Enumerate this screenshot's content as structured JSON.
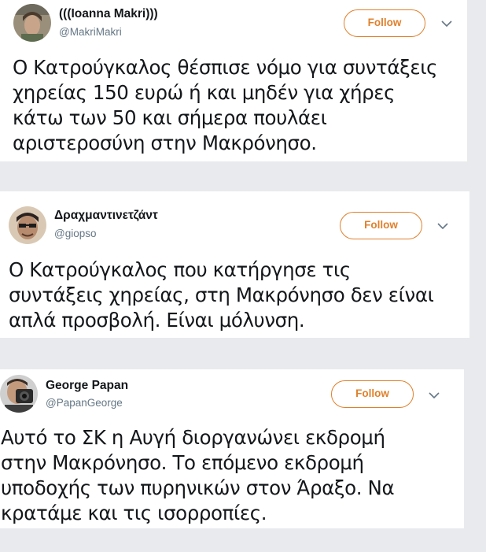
{
  "tweets": [
    {
      "name": "(((Ioanna Makri)))",
      "handle": "@MakriMakri",
      "follow_label": "Follow",
      "text": "Ο Κατρούγκαλος θέσπισε νόμο για συντάξεις\nχηρείας 150 ευρώ ή και μηδέν για χήρες\nκάτω των 50 και σήμερα πουλάει\nαριστεροσύνη στην Μακρόνησο."
    },
    {
      "name": "Δραχμαντινετζάντ",
      "handle": "@giopso",
      "follow_label": "Follow",
      "text": "Ο Κατρούγκαλος που κατήργησε τις\nσυντάξεις χηρείας, στη Μακρόνησο δεν είναι\nαπλά προσβολή. Είναι μόλυνση."
    },
    {
      "name": "George Papan",
      "handle": "@PapanGeorge",
      "follow_label": "Follow",
      "text": "Αυτό το ΣΚ η Αυγή διοργανώνει εκδρομή\nστην Μακρόνησο. Το επόμενο εκδρομή\nυποδοχής των πυρηνικών στον Άραξο. Να\nκρατάμε και τις ισορροπίες."
    }
  ],
  "colors": {
    "follow_accent": "#e0802c",
    "handle_gray": "#657786",
    "background": "#e8eaed"
  },
  "icons": {
    "more_menu": "chevron-down-icon"
  }
}
